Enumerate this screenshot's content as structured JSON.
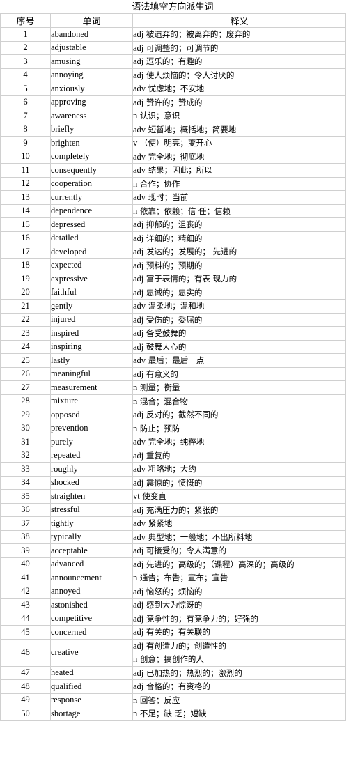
{
  "document": {
    "title": "语法填空方向派生词",
    "columns": [
      "序号",
      "单词",
      "释义"
    ],
    "rows": [
      {
        "num": "1",
        "word": "abandoned",
        "pos": "adj",
        "meaning": "被遗弃的；被离弃的；废弃的"
      },
      {
        "num": "2",
        "word": "adjustable",
        "pos": "adj",
        "meaning": "可调整的；可调节的"
      },
      {
        "num": "3",
        "word": "amusing",
        "pos": "adj",
        "meaning": "逗乐的；有趣的"
      },
      {
        "num": "4",
        "word": "annoying",
        "pos": "adj",
        "meaning": "使人烦恼的；令人讨厌的"
      },
      {
        "num": "5",
        "word": "anxiously",
        "pos": "adv",
        "meaning": "忧虑地；不安地"
      },
      {
        "num": "6",
        "word": "approving",
        "pos": "adj",
        "meaning": "赞许的；赞成的"
      },
      {
        "num": "7",
        "word": "awareness",
        "pos": "n",
        "meaning": "认识；意识"
      },
      {
        "num": "8",
        "word": "briefly",
        "pos": "adv",
        "meaning": "短暂地；概括地；简要地"
      },
      {
        "num": "9",
        "word": "brighten",
        "pos": "v",
        "meaning": "（使）明亮；变开心"
      },
      {
        "num": "10",
        "word": "completely",
        "pos": "adv",
        "meaning": "完全地；彻底地"
      },
      {
        "num": "11",
        "word": "consequently",
        "pos": "adv",
        "meaning": "结果；因此；所以"
      },
      {
        "num": "12",
        "word": "cooperation",
        "pos": "n",
        "meaning": "合作；协作"
      },
      {
        "num": "13",
        "word": "currently",
        "pos": "adv",
        "meaning": "现时；当前"
      },
      {
        "num": "14",
        "word": "dependence",
        "pos": "n",
        "meaning": "依靠；依赖；信 任；信赖"
      },
      {
        "num": "15",
        "word": "depressed",
        "pos": "adj",
        "meaning": "抑郁的；沮丧的"
      },
      {
        "num": "16",
        "word": "detailed",
        "pos": "adj",
        "meaning": "详细的；精细的"
      },
      {
        "num": "17",
        "word": "developed",
        "pos": "adj",
        "meaning": "发达的；发展的； 先进的"
      },
      {
        "num": "18",
        "word": "expected",
        "pos": "adj",
        "meaning": "预料的；预期的"
      },
      {
        "num": "19",
        "word": "expressive",
        "pos": "adj",
        "meaning": "富于表情的；有表 现力的"
      },
      {
        "num": "20",
        "word": "faithful",
        "pos": "adj",
        "meaning": "忠诚的；忠实的"
      },
      {
        "num": "21",
        "word": "gently",
        "pos": "adv",
        "meaning": "温柔地；温和地"
      },
      {
        "num": "22",
        "word": "injured",
        "pos": "adj",
        "meaning": "受伤的；委屈的"
      },
      {
        "num": "23",
        "word": "inspired",
        "pos": "adj",
        "meaning": "备受鼓舞的"
      },
      {
        "num": "24",
        "word": "inspiring",
        "pos": "adj",
        "meaning": "鼓舞人心的"
      },
      {
        "num": "25",
        "word": "lastly",
        "pos": "adv",
        "meaning": "最后；最后一点"
      },
      {
        "num": "26",
        "word": "meaningful",
        "pos": "adj",
        "meaning": "有意义的"
      },
      {
        "num": "27",
        "word": "measurement",
        "pos": "n",
        "meaning": "测量；衡量"
      },
      {
        "num": "28",
        "word": "mixture",
        "pos": "n",
        "meaning": "混合；混合物"
      },
      {
        "num": "29",
        "word": "opposed",
        "pos": "adj",
        "meaning": "反对的；截然不同的"
      },
      {
        "num": "30",
        "word": "prevention",
        "pos": "n",
        "meaning": "防止；预防"
      },
      {
        "num": "31",
        "word": "purely",
        "pos": "adv",
        "meaning": "完全地；纯粹地"
      },
      {
        "num": "32",
        "word": "repeated",
        "pos": "adj",
        "meaning": "重复的"
      },
      {
        "num": "33",
        "word": "roughly",
        "pos": "adv",
        "meaning": "粗略地；大约"
      },
      {
        "num": "34",
        "word": "shocked",
        "pos": "adj",
        "meaning": "震惊的；愤慨的"
      },
      {
        "num": "35",
        "word": "straighten",
        "pos": "vt",
        "meaning": "使变直"
      },
      {
        "num": "36",
        "word": "stressful",
        "pos": "adj",
        "meaning": "充满压力的；紧张的"
      },
      {
        "num": "37",
        "word": "tightly",
        "pos": "adv",
        "meaning": "紧紧地"
      },
      {
        "num": "38",
        "word": "typically",
        "pos": "adv",
        "meaning": "典型地；一般地；不出所料地"
      },
      {
        "num": "39",
        "word": "acceptable",
        "pos": "adj",
        "meaning": "可接受的；令人满意的"
      },
      {
        "num": "40",
        "word": "advanced",
        "pos": "adj",
        "meaning": "先进的；高级的；（课程）高深的；高级的"
      },
      {
        "num": "41",
        "word": "announcement",
        "pos": "n",
        "meaning": "通告；布告；宣布；宣告"
      },
      {
        "num": "42",
        "word": "annoyed",
        "pos": "adj",
        "meaning": "恼怒的；烦恼的"
      },
      {
        "num": "43",
        "word": "astonished",
        "pos": "adj",
        "meaning": "感到大为惊讶的"
      },
      {
        "num": "44",
        "word": "competitive",
        "pos": "adj",
        "meaning": "竞争性的；有竞争力的；好强的"
      },
      {
        "num": "45",
        "word": "concerned",
        "pos": "adj",
        "meaning": "有关的；有关联的"
      },
      {
        "num": "46",
        "word": "creative",
        "pos": "adj",
        "meaning": "有创造力的；创造性的",
        "pos2": "n",
        "meaning2": "创意；搞创作的人",
        "two_line": true
      },
      {
        "num": "47",
        "word": "heated",
        "pos": "adj",
        "meaning": "已加热的；热烈的；激烈的"
      },
      {
        "num": "48",
        "word": "qualified",
        "pos": "adj",
        "meaning": "合格的；有资格的"
      },
      {
        "num": "49",
        "word": "response",
        "pos": "n",
        "meaning": "回答；反应"
      },
      {
        "num": "50",
        "word": "shortage",
        "pos": "n",
        "meaning": "不足；缺 乏；短缺"
      }
    ]
  }
}
